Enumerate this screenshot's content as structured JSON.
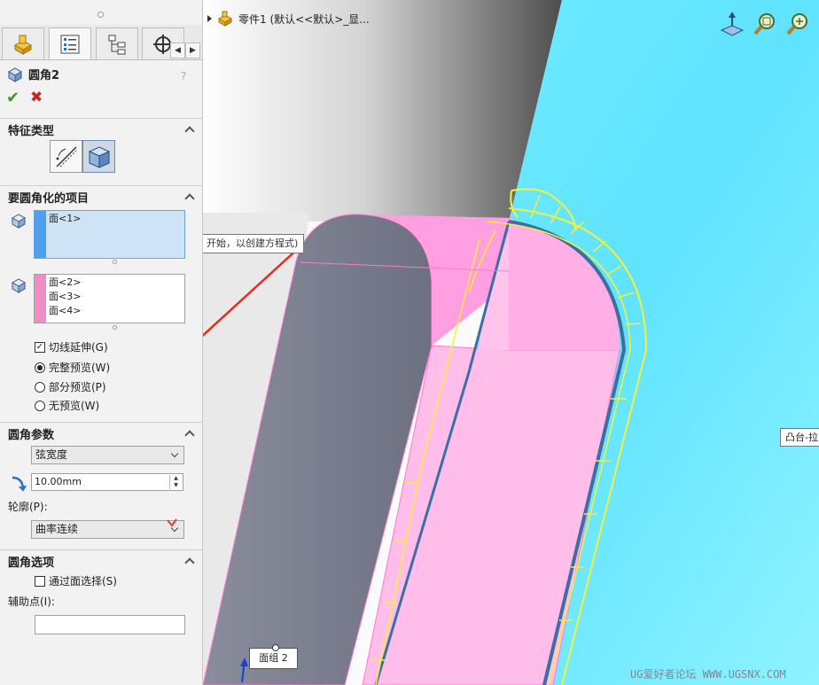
{
  "feature": {
    "title": "圆角2",
    "help": "?",
    "ok": "✔",
    "cancel": "✖"
  },
  "panel_tabs": [
    "feature-manager-icon",
    "property-manager-icon",
    "configuration-manager-icon",
    "dimxpert-icon"
  ],
  "sections": {
    "fillet_type": {
      "title": "特征类型"
    },
    "items": {
      "title": "要圆角化的项目",
      "set1": [
        "面<1>"
      ],
      "set2": [
        "面<2>",
        "面<3>",
        "面<4>"
      ],
      "tangent_propagation": "切线延伸(G)",
      "preview_full": "完整预览(W)",
      "preview_partial": "部分预览(P)",
      "preview_none": "无预览(W)"
    },
    "params": {
      "title": "圆角参数",
      "method": "弦宽度",
      "distance": "10.00mm",
      "profile_label": "轮廓(P):",
      "profile": "曲率连续"
    },
    "options": {
      "title": "圆角选项",
      "select_through_faces": "通过面选择(S)",
      "help_point_label": "辅助点(I):",
      "help_point_value": ""
    }
  },
  "viewport": {
    "tree_label": "零件1  (默认<<默认>_显...",
    "tooltip": "深度  (输入值或以 = 开始，以创建方程式)",
    "callout": "凸台-拉",
    "face_group": "面组 2",
    "watermark": "UG爱好者论坛 WWW.UGSNX.COM"
  },
  "colors": {
    "pink_face": "#ff9ee0",
    "cyan_body": "#62e6ff",
    "gray_face": "#7a7e8e",
    "yellow_preview": "#f4f03a",
    "arrow_red": "#e8291f"
  }
}
